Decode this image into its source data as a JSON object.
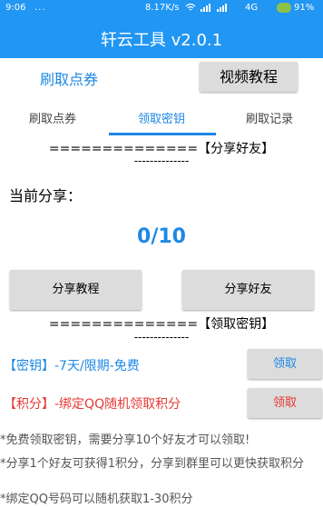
{
  "status_bar": {
    "time": "9:06",
    "dots": "...",
    "speed": "8.17K/s",
    "network": "4G",
    "battery": "91%"
  },
  "app": {
    "title": "轩云工具 v2.0.1"
  },
  "top_actions": {
    "coupon_link": "刷取点券",
    "video_button": "视频教程"
  },
  "tabs": [
    {
      "label": "刷取点券",
      "active": false
    },
    {
      "label": "领取密钥",
      "active": true
    },
    {
      "label": "刷取记录",
      "active": false
    }
  ],
  "share_section": {
    "header": "==============【分享好友】",
    "underline": "--------------",
    "current_label": "当前分享：",
    "count": "0/10",
    "tutorial_button": "分享教程",
    "share_button": "分享好友"
  },
  "claim_section": {
    "header": "==============【领取密钥】",
    "underline": "--------------",
    "key_line": "【密钥】-7天/限期-免费",
    "key_button": "领取",
    "points_line": "【积分】-绑定QQ随机领取积分",
    "points_button": "领取"
  },
  "notes": [
    "*免费领取密钥，需要分享10个好友才可以领取!",
    "*分享1个好友可获得1积分，分享到群里可以更快获取积分",
    "*绑定QQ号码可以随机获取1-30积分"
  ],
  "colors": {
    "primary": "#2196f3",
    "accent_text": "#1e88e5",
    "danger": "#e53935",
    "button_bg": "#dcdcdc"
  }
}
